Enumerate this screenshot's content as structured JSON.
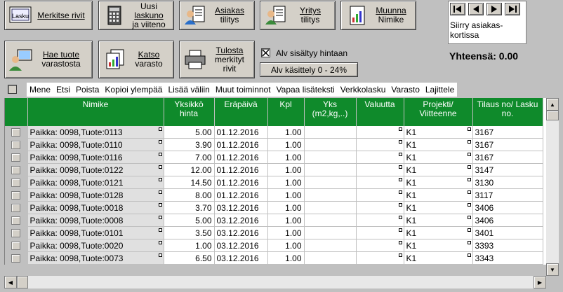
{
  "toolbar": {
    "mark_rows": "Merkitse rivit",
    "mark_rows_icon_text": "Lasku",
    "new_invoice": [
      "Uusi",
      "laskuno",
      "ja viiteno"
    ],
    "customer_account": [
      "Asiakas",
      "tilitys"
    ],
    "company_account": [
      "Yritys",
      "tilitys"
    ],
    "convert_name": [
      "Muunna",
      "Nimike"
    ],
    "fetch_product": [
      "Hae tuote",
      "varastosta"
    ],
    "view_stock": [
      "Katso",
      "varasto"
    ],
    "print_marked": [
      "Tulosta",
      "merkityt",
      "rivit"
    ]
  },
  "nav": {
    "label": "Siirry asiakas-kortissa"
  },
  "total": "Yhteensä: 0.00",
  "vat_included": {
    "label": "Alv sisältyy hintaan",
    "checked": true
  },
  "vat_button": "Alv käsittely 0 - 24%",
  "menu": [
    "Mene",
    "Etsi",
    "Poista",
    "Kopioi ylempää",
    "Lisää väliin",
    "Muut toiminnot",
    "Vapaa lisäteksti",
    "Verkkolasku",
    "Varasto",
    "Lajittele"
  ],
  "columns": [
    "",
    "Nimike",
    "Yksikkö hinta",
    "Eräpäivä",
    "Kpl",
    "Yks (m2,kg,..)",
    "Valuutta",
    "Projekti/ Viitteenne",
    "Tilaus no/ Lasku no."
  ],
  "rows": [
    [
      "Paikka: 0098,Tuote:0113",
      "5.00",
      "01.12.2016",
      "1.00",
      "",
      "",
      "K1",
      "3167"
    ],
    [
      "Paikka: 0098,Tuote:0110",
      "3.90",
      "01.12.2016",
      "1.00",
      "",
      "",
      "K1",
      "3167"
    ],
    [
      "Paikka: 0098,Tuote:0116",
      "7.00",
      "01.12.2016",
      "1.00",
      "",
      "",
      "K1",
      "3167"
    ],
    [
      "Paikka: 0098,Tuote:0122",
      "12.00",
      "01.12.2016",
      "1.00",
      "",
      "",
      "K1",
      "3147"
    ],
    [
      "Paikka: 0098,Tuote:0121",
      "14.50",
      "01.12.2016",
      "1.00",
      "",
      "",
      "K1",
      "3130"
    ],
    [
      "Paikka: 0098,Tuote:0128",
      "8.00",
      "01.12.2016",
      "1.00",
      "",
      "",
      "K1",
      "3117"
    ],
    [
      "Paikka: 0098,Tuote:0018",
      "3.70",
      "03.12.2016",
      "1.00",
      "",
      "",
      "K1",
      "3406"
    ],
    [
      "Paikka: 0098,Tuote:0008",
      "5.00",
      "03.12.2016",
      "1.00",
      "",
      "",
      "K1",
      "3406"
    ],
    [
      "Paikka: 0098,Tuote:0101",
      "3.50",
      "03.12.2016",
      "1.00",
      "",
      "",
      "K1",
      "3401"
    ],
    [
      "Paikka: 0098,Tuote:0020",
      "1.00",
      "03.12.2016",
      "1.00",
      "",
      "",
      "K1",
      "3393"
    ],
    [
      "Paikka: 0098,Tuote:0073",
      "6.50",
      "03.12.2016",
      "1.00",
      "",
      "",
      "K1",
      "3343"
    ]
  ],
  "colors": {
    "header_green": "#0f8a2b",
    "window_gray": "#c0c0c0"
  }
}
